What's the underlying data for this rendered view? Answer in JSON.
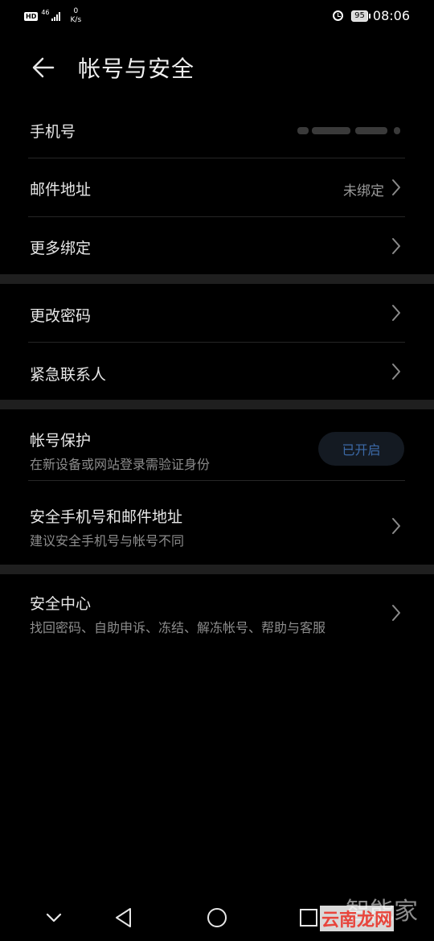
{
  "status_bar": {
    "hd": "HD",
    "network": "46",
    "speed_value": "0",
    "speed_unit": "K/s",
    "battery": "95",
    "time": "08:06"
  },
  "header": {
    "title": "帐号与安全"
  },
  "rows": {
    "phone": {
      "label": "手机号"
    },
    "email": {
      "label": "邮件地址",
      "value": "未绑定"
    },
    "more_binding": {
      "label": "更多绑定"
    },
    "change_password": {
      "label": "更改密码"
    },
    "emergency_contact": {
      "label": "紧急联系人"
    },
    "account_protection": {
      "label": "帐号保护",
      "subtitle": "在新设备或网站登录需验证身份",
      "status": "已开启"
    },
    "secure_phone_email": {
      "label": "安全手机号和邮件地址",
      "subtitle": "建议安全手机号与帐号不同"
    },
    "security_center": {
      "label": "安全中心",
      "subtitle": "找回密码、自助申诉、冻结、解冻帐号、帮助与客服"
    }
  },
  "watermark": {
    "top": "智能家",
    "bottom": "云南龙网"
  },
  "colors": {
    "background": "#000000",
    "section_gap": "#1f1f1f",
    "accent": "#3c6aa8"
  }
}
